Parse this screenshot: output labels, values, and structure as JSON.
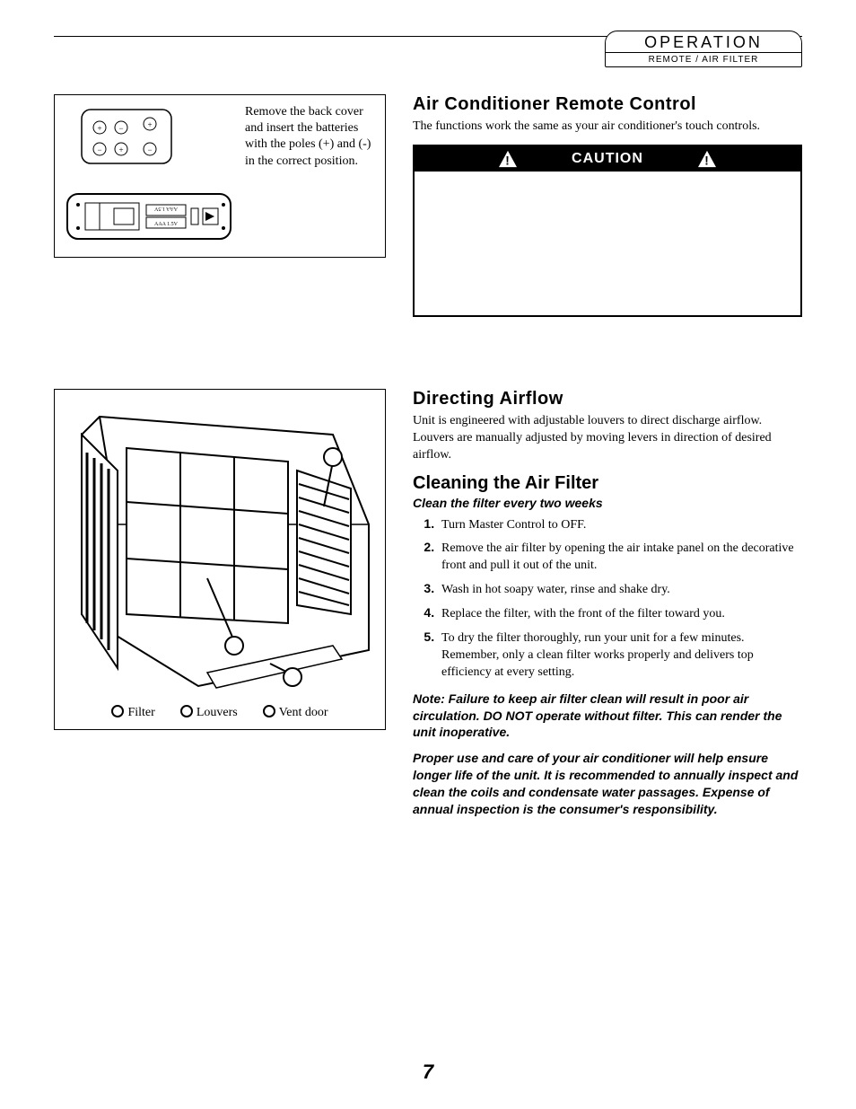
{
  "header": {
    "title": "OPERATION",
    "subtitle": "REMOTE / AIR FILTER"
  },
  "remote": {
    "caption": "Remove the back cover and insert the batteries with the poles (+) and (-) in the correct position.",
    "battery_label_1": "AAA 1.5V",
    "battery_label_2": "AAA 1.5V"
  },
  "section1": {
    "heading": "Air Conditioner Remote Control",
    "intro": "The functions work the same as your air conditioner's touch controls.",
    "caution_label": "CAUTION"
  },
  "figure2": {
    "legend": {
      "a": "Filter",
      "b": "Louvers",
      "c": "Vent door"
    }
  },
  "section2": {
    "heading": "Directing Airflow",
    "body": "Unit is engineered with adjustable louvers to direct discharge airflow. Louvers are manually adjusted by moving levers in direction of desired airflow."
  },
  "section3": {
    "heading": "Cleaning the Air Filter",
    "sub": "Clean the filter every two weeks",
    "steps": [
      "Turn Master Control to OFF.",
      "Remove the air filter by opening the air intake panel on the decorative front and  pull it out of the unit.",
      "Wash in hot soapy water, rinse and shake dry.",
      "Replace the filter, with the front of the filter toward you.",
      "To dry the filter thoroughly, run your unit for a few minutes. Remember, only a clean filter works properly and delivers top efficiency at every setting."
    ],
    "note1": "Note: Failure to keep air filter clean will result in poor air circulation. DO NOT operate without filter. This can render the unit inoperative.",
    "note2": "Proper use and care of your air conditioner will help ensure longer life of the unit. It is recommended to annually inspect and clean the coils and condensate water passages. Expense of annual inspection is the consumer's responsibility."
  },
  "page_number": "7"
}
